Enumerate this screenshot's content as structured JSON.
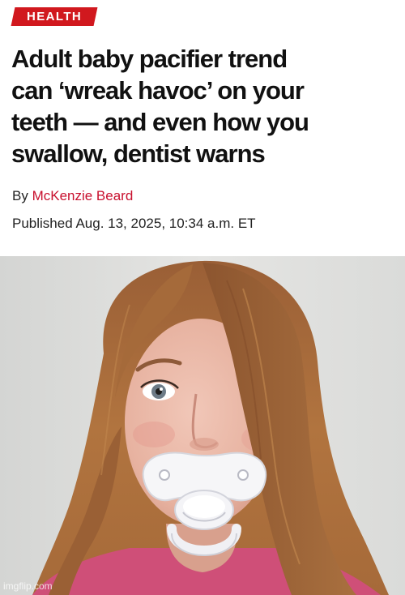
{
  "article": {
    "section_tag": "HEALTH",
    "headline_lines": [
      "Adult baby pacifier trend",
      "can ‘wreak havoc’ on your",
      "teeth — and even how you",
      "swallow, dentist warns"
    ],
    "byline_prefix": "By ",
    "author": "McKenzie Beard",
    "published": "Published Aug. 13, 2025, 10:34 a.m. ET"
  },
  "image": {
    "watermark": "imgflip.com"
  },
  "colors": {
    "accent": "#d1181e",
    "author_link": "#c8102e",
    "text": "#111111",
    "background": "#ffffff"
  }
}
